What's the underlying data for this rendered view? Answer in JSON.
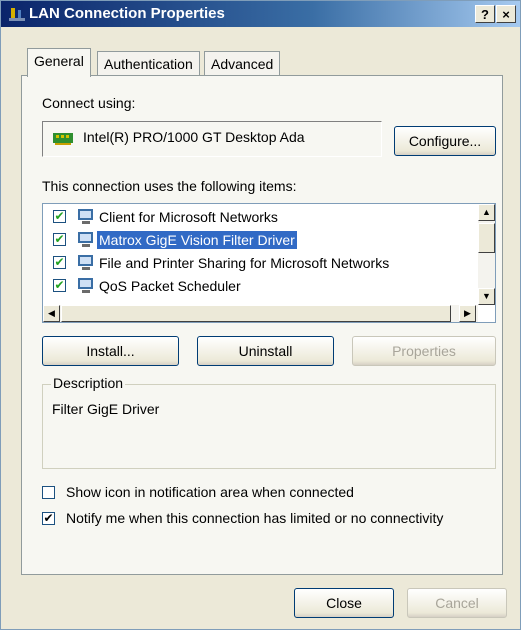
{
  "window": {
    "title": "LAN Connection Properties",
    "help_label": "?",
    "close_label": "×"
  },
  "tabs": [
    {
      "label": "General",
      "active": true
    },
    {
      "label": "Authentication",
      "active": false
    },
    {
      "label": "Advanced",
      "active": false
    }
  ],
  "connect_using": {
    "label": "Connect using:",
    "adapter": "Intel(R) PRO/1000 GT Desktop Ada",
    "configure_button": "Configure..."
  },
  "items_section": {
    "label": "This connection uses the following items:",
    "items": [
      {
        "label": "Client for Microsoft Networks",
        "checked": true,
        "selected": false
      },
      {
        "label": "Matrox GigE Vision Filter Driver",
        "checked": true,
        "selected": true
      },
      {
        "label": "File and Printer Sharing for Microsoft Networks",
        "checked": true,
        "selected": false
      },
      {
        "label": "QoS Packet Scheduler",
        "checked": true,
        "selected": false
      }
    ]
  },
  "item_buttons": {
    "install": "Install...",
    "uninstall": "Uninstall",
    "properties": "Properties"
  },
  "description": {
    "legend": "Description",
    "text": "Filter GigE Driver"
  },
  "options": {
    "show_icon": {
      "label": "Show icon in notification area when connected",
      "checked": false
    },
    "notify": {
      "label": "Notify me when this connection has limited or no connectivity",
      "checked": true
    }
  },
  "footer": {
    "close": "Close",
    "cancel": "Cancel"
  }
}
